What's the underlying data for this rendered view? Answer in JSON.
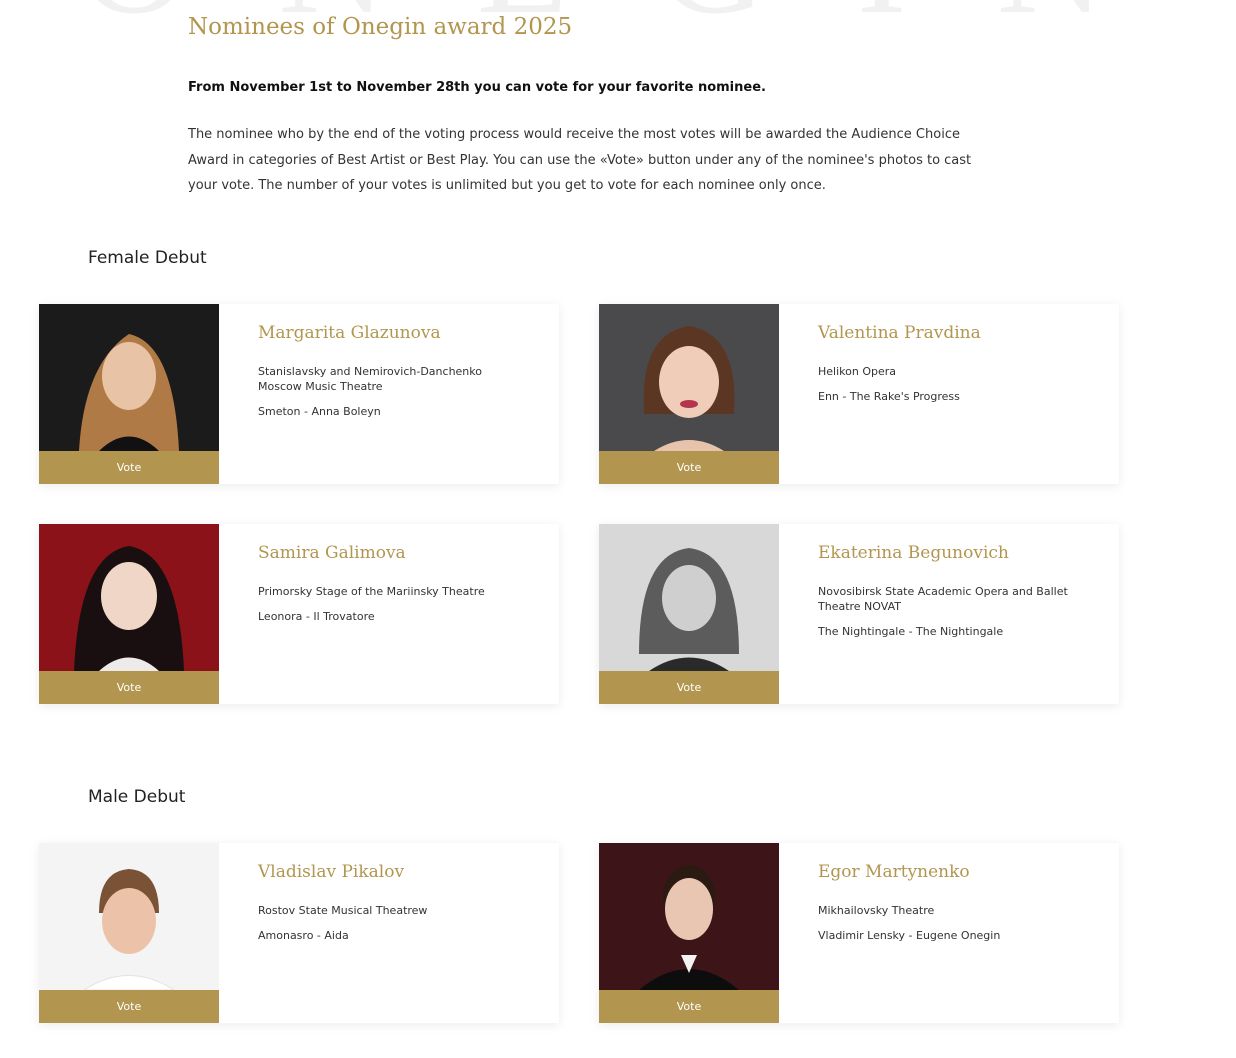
{
  "page": {
    "title": "Nominees of Onegin award 2025",
    "lead": "From November 1st to November 28th you can vote for your favorite nominee.",
    "intro": "The nominee who by the end of the voting process would receive the most votes will be awarded the Audience Choice Award in categories of Best Artist or Best Play. You can use the «Vote» button under any of the nominee's photos to cast your vote. The number of your votes is unlimited but you get to vote for each nominee only once."
  },
  "colors": {
    "accent": "#b2964f",
    "text": "#222222",
    "background": "#ffffff"
  },
  "sections": [
    {
      "title": "Female Debut",
      "nominees": [
        {
          "name": "Margarita Glazunova",
          "theatre": "Stanislavsky and Nemirovich-Danchenko Moscow Music Theatre",
          "role": "Smeton - Anna Boleyn",
          "vote_label": "Vote"
        },
        {
          "name": "Valentina Pravdina",
          "theatre": "Helikon Opera",
          "role": "Enn - The Rake's Progress",
          "vote_label": "Vote"
        },
        {
          "name": "Samira Galimova",
          "theatre": "Primorsky Stage of the Mariinsky Theatre",
          "role": "Leonora - Il Trovatore",
          "vote_label": "Vote"
        },
        {
          "name": "Ekaterina Begunovich",
          "theatre": "Novosibirsk State Academic Opera and Ballet Theatre NOVAT",
          "role": "The Nightingale - The Nightingale",
          "vote_label": "Vote"
        }
      ]
    },
    {
      "title": "Male Debut",
      "nominees": [
        {
          "name": "Vladislav Pikalov",
          "theatre": "Rostov State Musical Theatrew",
          "role": "Amonasro - Aida",
          "vote_label": "Vote"
        },
        {
          "name": "Egor Martynenko",
          "theatre": "Mikhailovsky Theatre",
          "role": "Vladimir Lensky - Eugene Onegin",
          "vote_label": "Vote"
        }
      ]
    }
  ]
}
